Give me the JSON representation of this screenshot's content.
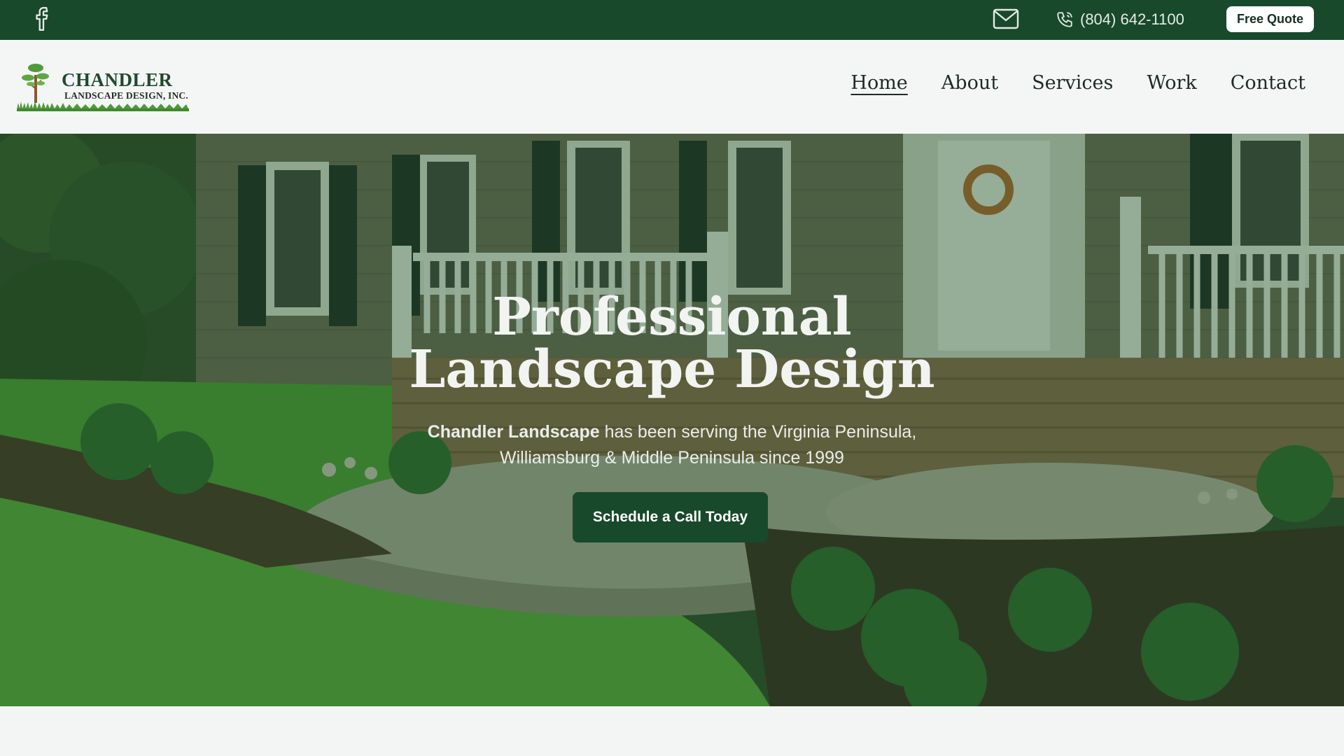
{
  "topbar": {
    "facebook_icon": "facebook-icon",
    "mail_icon": "mail-icon",
    "phone_icon": "phone-icon",
    "phone_number": "(804) 642-1100",
    "quote_label": "Free Quote"
  },
  "logo": {
    "name": "CHANDLER",
    "subtitle": "LANDSCAPE DESIGN, INC."
  },
  "nav": {
    "items": [
      {
        "label": "Home",
        "active": true
      },
      {
        "label": "About",
        "active": false
      },
      {
        "label": "Services",
        "active": false
      },
      {
        "label": "Work",
        "active": false
      },
      {
        "label": "Contact",
        "active": false
      }
    ]
  },
  "hero": {
    "title_line1": "Professional",
    "title_line2": "Landscape Design",
    "subtitle_bold": "Chandler Landscape",
    "subtitle_rest": "has been serving the Virginia Peninsula, Williamsburg & Middle Peninsula since 1999",
    "cta_label": "Schedule a Call Today"
  },
  "colors": {
    "brand_green": "#18492b",
    "page_background": "#f3f5f5",
    "hero_overlay": "rgba(24,78,40,0.38)"
  }
}
